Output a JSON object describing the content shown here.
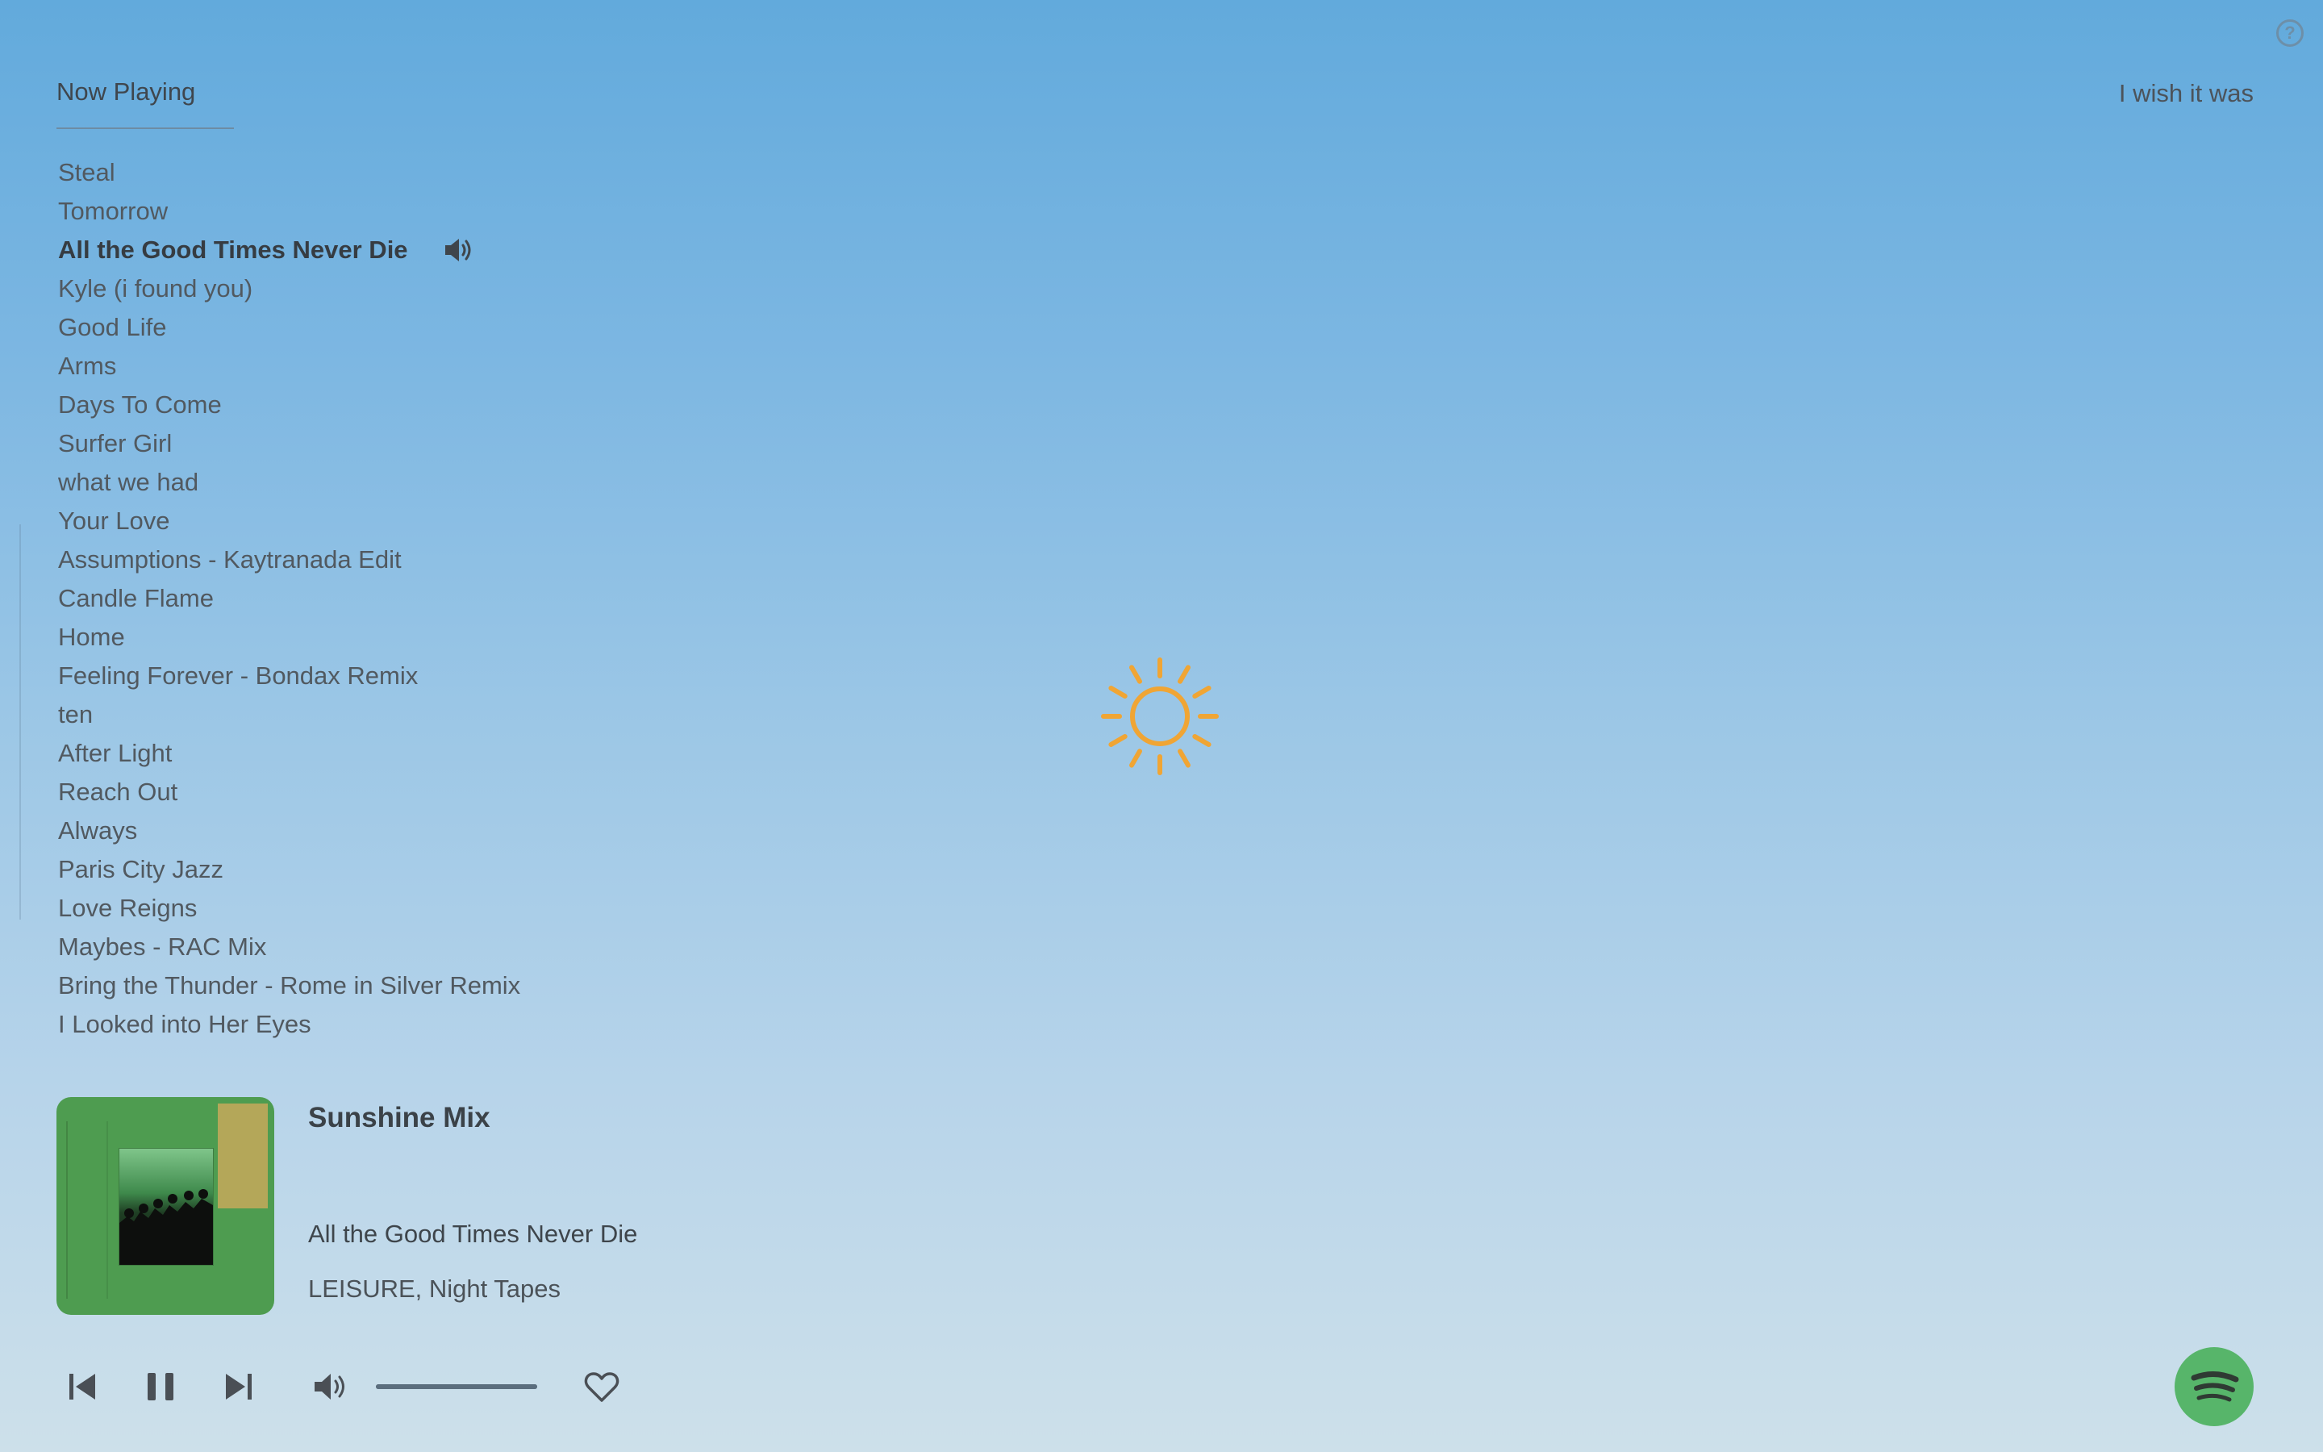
{
  "header": {
    "now_playing_tab": "Now Playing",
    "top_right_text": "I wish it was",
    "help_icon": "question-circle-icon"
  },
  "tracklist": {
    "current_index": 2,
    "items": [
      "Steal",
      "Tomorrow",
      "All the Good Times Never Die",
      "Kyle (i found you)",
      "Good Life",
      "Arms",
      "Days To Come",
      "Surfer Girl",
      "what we had",
      "Your Love",
      "Assumptions - Kaytranada Edit",
      "Candle Flame",
      "Home",
      "Feeling Forever - Bondax Remix",
      "ten",
      "After Light",
      "Reach Out",
      "Always",
      "Paris City Jazz",
      "Love Reigns",
      "Maybes - RAC Mix",
      "Bring the Thunder - Rome in Silver Remix",
      "I Looked into Her Eyes"
    ],
    "playing_icon": "speaker-icon"
  },
  "center": {
    "weather_icon": "sun-icon",
    "sun_color": "#f0a534"
  },
  "player": {
    "playlist_name": "Sunshine Mix",
    "song_title": "All the Good Times Never Die",
    "artist": "LEISURE, Night Tapes",
    "volume": 1.0,
    "controls": [
      "previous-icon",
      "pause-icon",
      "next-icon",
      "volume-icon",
      "heart-icon"
    ]
  },
  "brand": {
    "logo": "spotify-icon",
    "color": "#57b56a"
  }
}
